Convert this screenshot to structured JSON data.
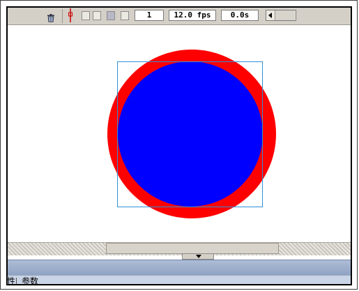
{
  "timeline": {
    "current_frame": "1",
    "frame_rate": "12.0 fps",
    "elapsed_time": "0.0s"
  },
  "properties_panel": {
    "tabs": [
      "属性",
      "参数"
    ]
  },
  "icons": [
    "trash-icon",
    "center-frame-icon",
    "onion-skin-icon",
    "onion-skin-outlines-icon",
    "edit-multiple-frames-icon",
    "modify-onion-markers-icon",
    "scroll-left-arrow-icon",
    "collapse-arrow-icon"
  ],
  "colors": {
    "outer_circle": "#ff0000",
    "inner_circle": "#0000ff",
    "selection_box": "#2f8fd8",
    "playhead": "#cc0000"
  }
}
